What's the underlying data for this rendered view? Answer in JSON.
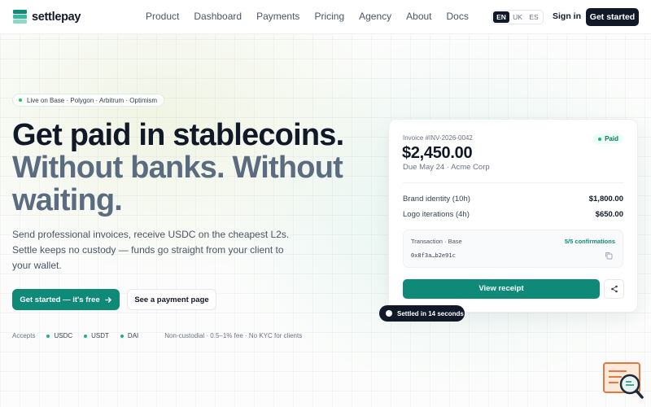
{
  "brand": {
    "name": "settlepay",
    "accent": "#0f8a79",
    "dark": "#111827"
  },
  "nav": {
    "items": [
      "Product",
      "Dashboard",
      "Payments",
      "Pricing",
      "Agency",
      "About",
      "Docs"
    ]
  },
  "lang": {
    "options": [
      "EN",
      "UK",
      "ES"
    ],
    "selected": "EN"
  },
  "header": {
    "signin": "Sign in",
    "cta": "Get started"
  },
  "hero": {
    "pill": "Live on Base · Polygon · Arbitrum · Optimism",
    "title_line1": "Get paid in stablecoins.",
    "title_line2": "Without banks. Without waiting.",
    "subtitle": "Send professional invoices, receive USDC on the cheapest L2s. Settle keeps no custody — funds go straight from your client to your wallet.",
    "primary_cta": "Get started — it's free",
    "secondary_cta": "See a payment page",
    "accepts_label": "Accepts",
    "coins": [
      "USDC",
      "USDT",
      "DAI"
    ],
    "note": "Non-custodial · 0.5–1% fee · No KYC for clients"
  },
  "invoice": {
    "number": "Invoice #INV-2026-0042",
    "status": "Paid",
    "amount": "$2,450.00",
    "due": "Due May 24 · Acme Corp",
    "lines": [
      {
        "desc": "Brand identity (10h)",
        "amount": "$1,800.00"
      },
      {
        "desc": "Logo iterations (4h)",
        "amount": "$650.00"
      }
    ],
    "tx_label": "Transaction · Base",
    "confirmations": "5/5 confirmations",
    "tx_hash": "0x8f3a…b2e91c",
    "view_receipt": "View receipt"
  },
  "toast": {
    "text": "Settled in 14 seconds"
  },
  "icons": [
    "logo-mark-icon",
    "arrow-right-icon",
    "copy-icon",
    "share-icon",
    "search-document-icon"
  ]
}
